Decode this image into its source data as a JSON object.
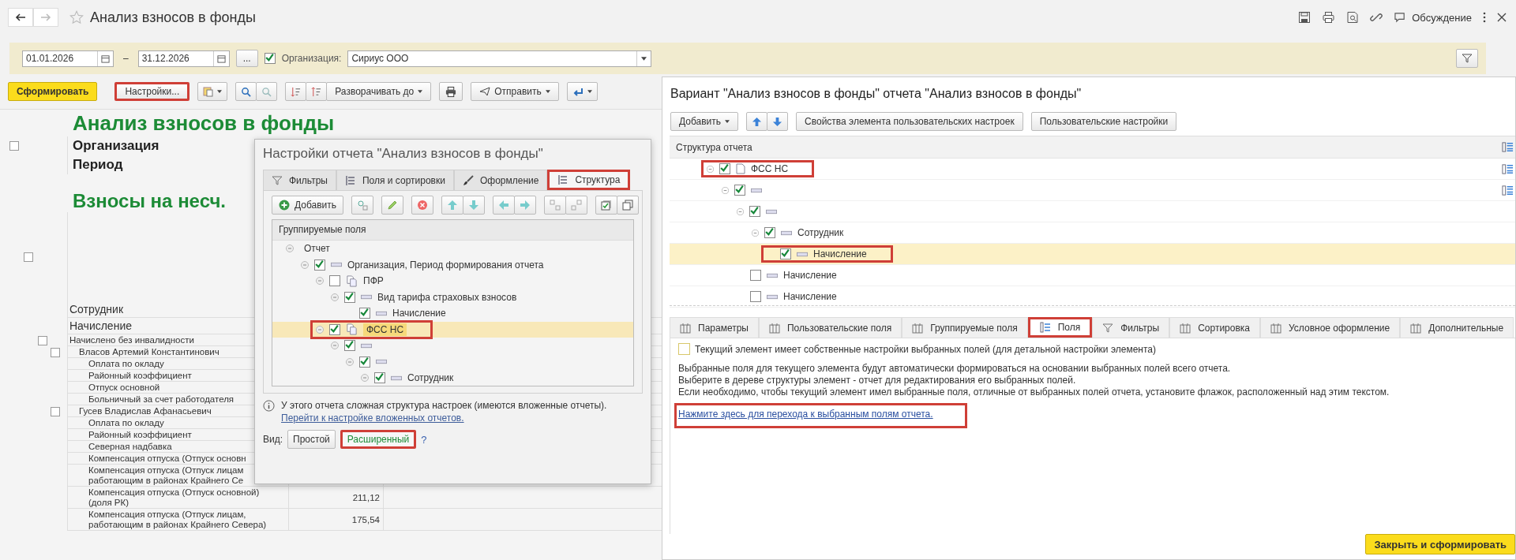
{
  "window": {
    "title": "Анализ взносов в фонды",
    "discussion": "Обсуждение"
  },
  "filter": {
    "date_from": "01.01.2026",
    "dash": "–",
    "date_to": "31.12.2026",
    "more": "...",
    "org_enabled": true,
    "org_label": "Организация:",
    "org_value": "Сириус ООО"
  },
  "toolbar": {
    "generate": "Сформировать",
    "settings": {
      "label": "Настройки...",
      "highlighted": true
    },
    "expand": "Разворачивать до",
    "send": "Отправить"
  },
  "report": {
    "title": "Анализ взносов в фонды",
    "org_label": "Организация",
    "period_label": "Период",
    "section": "Взносы на несч.",
    "headers": [
      "Сотрудник",
      "Начисление"
    ],
    "rows": [
      {
        "text": "Начислено без инвалидности",
        "children": [
          {
            "text": "Власов Артемий Константинович",
            "children": [
              {
                "text": "Оплата по окладу"
              },
              {
                "text": "Районный коэффициент"
              },
              {
                "text": "Отпуск основной"
              },
              {
                "text": "Больничный за счет работодателя"
              }
            ]
          },
          {
            "text": "Гусев Владислав Афанасьевич",
            "children": [
              {
                "text": "Оплата по окладу"
              },
              {
                "text": "Районный коэффициент"
              },
              {
                "text": "Северная надбавка"
              },
              {
                "text": "Компенсация отпуска (Отпуск основн"
              },
              {
                "text": "Компенсация отпуска (Отпуск лицам\nработающим в районах Крайнего Се"
              },
              {
                "text": "Компенсация отпуска (Отпуск основной)\n(доля РК)",
                "value": "211,12"
              },
              {
                "text": "Компенсация отпуска (Отпуск лицам,\nработающим в районах Крайнего Севера)",
                "value": "175,54"
              }
            ]
          }
        ]
      }
    ]
  },
  "settings_dialog": {
    "title": "Настройки отчета \"Анализ взносов в фонды\"",
    "tabs": [
      {
        "label": "Фильтры",
        "kind": "filter",
        "selected": false,
        "highlighted": false
      },
      {
        "label": "Поля и сортировки",
        "kind": "fields",
        "selected": false,
        "highlighted": false
      },
      {
        "label": "Оформление",
        "kind": "brush",
        "selected": false,
        "highlighted": false
      },
      {
        "label": "Структура",
        "kind": "structure",
        "selected": true,
        "highlighted": true
      }
    ],
    "add": "Добавить",
    "tree_header": "Группируемые поля",
    "tree": [
      {
        "label": "Отчет",
        "kind": "root",
        "collapsible": true,
        "selected": false,
        "highlighted": false,
        "children": [
          {
            "label": "Организация, Период формирования отчета",
            "kind": "group",
            "checked": true,
            "collapsible": true,
            "selected": false,
            "highlighted": false,
            "children": [
              {
                "label": "ПФР",
                "kind": "report",
                "checked": false,
                "collapsible": true,
                "selected": false,
                "highlighted": false,
                "children": [
                  {
                    "label": "Вид тарифа страховых взносов",
                    "kind": "group",
                    "checked": true,
                    "collapsible": true,
                    "selected": false,
                    "highlighted": false,
                    "children": [
                      {
                        "label": "Начисление",
                        "kind": "group",
                        "checked": true,
                        "collapsible": false,
                        "selected": false,
                        "highlighted": false
                      }
                    ]
                  }
                ]
              },
              {
                "label": "ФСС НС",
                "kind": "report",
                "checked": true,
                "collapsible": true,
                "selected": true,
                "highlighted": true,
                "children": [
                  {
                    "kind": "group",
                    "checked": true,
                    "collapsible": true,
                    "selected": false,
                    "highlighted": false,
                    "children": [
                      {
                        "kind": "group",
                        "checked": true,
                        "collapsible": true,
                        "selected": false,
                        "highlighted": false,
                        "children": [
                          {
                            "label": "Сотрудник",
                            "kind": "group",
                            "checked": true,
                            "collapsible": true,
                            "selected": false,
                            "highlighted": false
                          }
                        ]
                      }
                    ]
                  }
                ]
              }
            ]
          }
        ]
      }
    ],
    "info": "У этого отчета сложная структура настроек (имеются вложенные отчеты).",
    "info_link": "Перейти к настройке вложенных отчетов.",
    "view_label": "Вид:",
    "views": [
      {
        "label": "Простой",
        "selected": false,
        "highlighted": false
      },
      {
        "label": "Расширенный",
        "selected": true,
        "highlighted": true
      }
    ],
    "help": "?"
  },
  "variant_panel": {
    "title": "Вариант \"Анализ взносов в фонды\" отчета \"Анализ взносов в фонды\"",
    "add": "Добавить",
    "properties": "Свойства элемента пользовательских настроек",
    "user_settings": "Пользовательские настройки",
    "tree_header": "Структура отчета",
    "tree": [
      {
        "label": "ФСС НС",
        "kind": "report",
        "checked": true,
        "collapsible": true,
        "selected": false,
        "highlighted": true,
        "own_settings": true,
        "children": [
          {
            "kind": "group",
            "checked": true,
            "collapsible": true,
            "selected": false,
            "highlighted": false,
            "own_settings": true,
            "children": [
              {
                "kind": "group",
                "checked": true,
                "collapsible": true,
                "selected": false,
                "highlighted": false,
                "own_settings": false,
                "children": [
                  {
                    "label": "Сотрудник",
                    "kind": "group",
                    "checked": true,
                    "collapsible": true,
                    "selected": false,
                    "highlighted": false,
                    "own_settings": false,
                    "children": [
                      {
                        "label": "Начисление",
                        "kind": "group",
                        "checked": true,
                        "collapsible": false,
                        "selected": true,
                        "highlighted": true,
                        "own_settings": false
                      }
                    ]
                  }
                ]
              },
              {
                "label": "Начисление",
                "kind": "group",
                "checked": false,
                "collapsible": false,
                "selected": false,
                "highlighted": false,
                "own_settings": false
              },
              {
                "label": "Начисление",
                "kind": "group",
                "checked": false,
                "collapsible": false,
                "selected": false,
                "highlighted": false,
                "own_settings": false
              }
            ]
          }
        ]
      }
    ],
    "tabs": [
      {
        "label": "Параметры",
        "kind": "params",
        "selected": false,
        "highlighted": false
      },
      {
        "label": "Пользовательские поля",
        "kind": "custom",
        "selected": false,
        "highlighted": false
      },
      {
        "label": "Группируемые поля",
        "kind": "grouping",
        "selected": false,
        "highlighted": false
      },
      {
        "label": "Поля",
        "kind": "fields",
        "selected": true,
        "highlighted": true
      },
      {
        "label": "Фильтры",
        "kind": "filter",
        "selected": false,
        "highlighted": false
      },
      {
        "label": "Сортировка",
        "kind": "sort",
        "selected": false,
        "highlighted": false
      },
      {
        "label": "Условное оформление",
        "kind": "conditional",
        "selected": false,
        "highlighted": false
      },
      {
        "label": "Дополнительные",
        "kind": "extra",
        "selected": false,
        "highlighted": false
      }
    ],
    "own_fields": {
      "checked": false,
      "label": "Текущий элемент имеет собственные настройки выбранных полей (для детальной настройки элемента)"
    },
    "description": [
      "Выбранные поля для текущего элемента будут автоматически формироваться на основании выбранных полей всего отчета.",
      "Выберите в дереве структуры элемент - отчет для редактирования его выбранных полей.",
      "Если необходимо, чтобы текущий элемент имел выбранные поля, отличные от выбранных полей отчета, установите флажок, расположенный над этим текстом."
    ],
    "link": {
      "label": "Нажмите здесь для перехода к выбранным полям отчета.",
      "highlighted": true
    },
    "close_button": "Закрыть и сформировать"
  }
}
